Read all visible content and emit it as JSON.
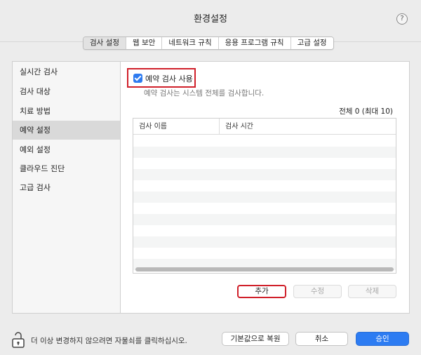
{
  "window": {
    "title": "환경설정",
    "help_label": "?"
  },
  "tabs": [
    {
      "label": "검사 설정",
      "active": true
    },
    {
      "label": "웹 보안"
    },
    {
      "label": "네트워크 규칙"
    },
    {
      "label": "응용 프로그램 규칙"
    },
    {
      "label": "고급 설정"
    }
  ],
  "sidebar": {
    "items": [
      {
        "label": "실시간 검사"
      },
      {
        "label": "검사 대상"
      },
      {
        "label": "치료 방법"
      },
      {
        "label": "예약 설정",
        "selected": true
      },
      {
        "label": "예외 설정"
      },
      {
        "label": "클라우드 진단"
      },
      {
        "label": "고급 검사"
      }
    ]
  },
  "schedule": {
    "enable_label": "예약 검사 사용",
    "enabled": true,
    "description": "예약 검사는 시스템 전체를 검사합니다.",
    "count_label": "전체 0 (최대 10)",
    "columns": [
      "검사 이름",
      "검사 시간"
    ],
    "add_label": "추가",
    "edit_label": "수정",
    "delete_label": "삭제"
  },
  "footer": {
    "lock_text": "더 이상 변경하지 않으려면 자물쇠를 클릭하십시오.",
    "restore_label": "기본값으로 복원",
    "cancel_label": "취소",
    "ok_label": "승인"
  },
  "colors": {
    "accent": "#2d7cf2",
    "highlight": "#d0202a"
  }
}
